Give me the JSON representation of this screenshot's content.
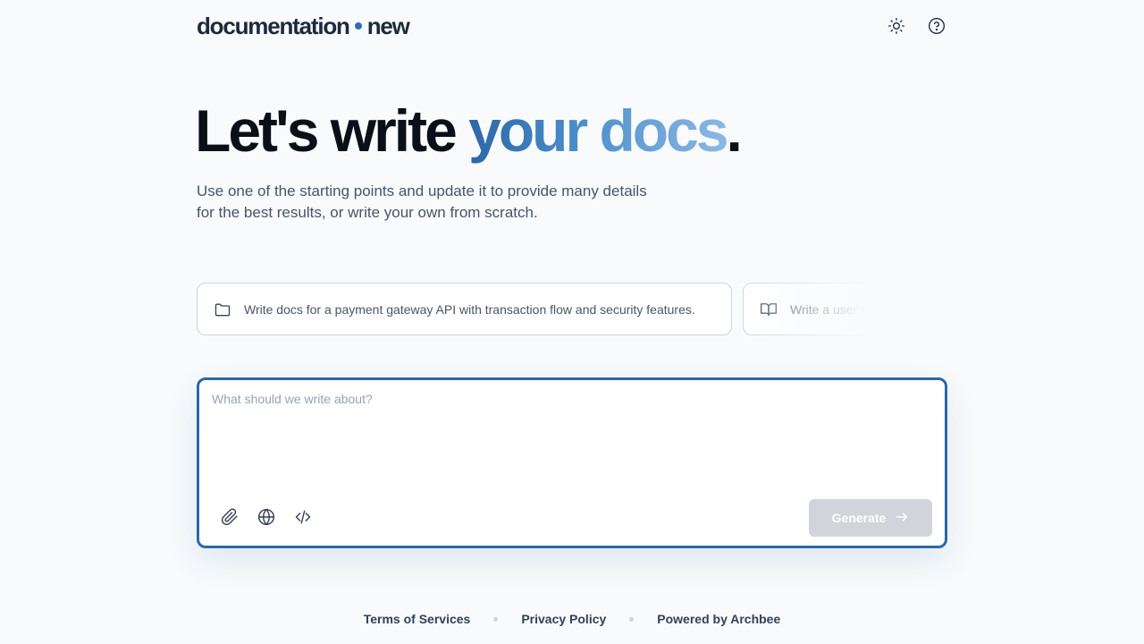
{
  "header": {
    "logo_left": "documentation",
    "logo_right": "new",
    "accent_color": "#2f6fb3",
    "icons": [
      "sun-icon",
      "help-circle-icon"
    ]
  },
  "hero": {
    "title_prefix": "Let's write ",
    "title_accent": "your docs",
    "title_suffix": "."
  },
  "subtitle": {
    "line1": "Use one of the starting points and update it to provide many details",
    "line2": "for the best results, or write your own from scratch."
  },
  "suggestions": [
    {
      "icon": "folder-icon",
      "text": "Write docs for a payment gateway API with transaction flow and security features."
    },
    {
      "icon": "book-open-icon",
      "text": "Write a user guide for"
    }
  ],
  "prompt": {
    "placeholder": "What should we write about?",
    "value": "",
    "tools": [
      "paperclip-icon",
      "globe-icon",
      "code-icon"
    ],
    "generate_label": "Generate",
    "border_color": "#2c67a8"
  },
  "footer": {
    "links": [
      "Terms of Services",
      "Privacy Policy",
      "Powered by Archbee"
    ]
  }
}
